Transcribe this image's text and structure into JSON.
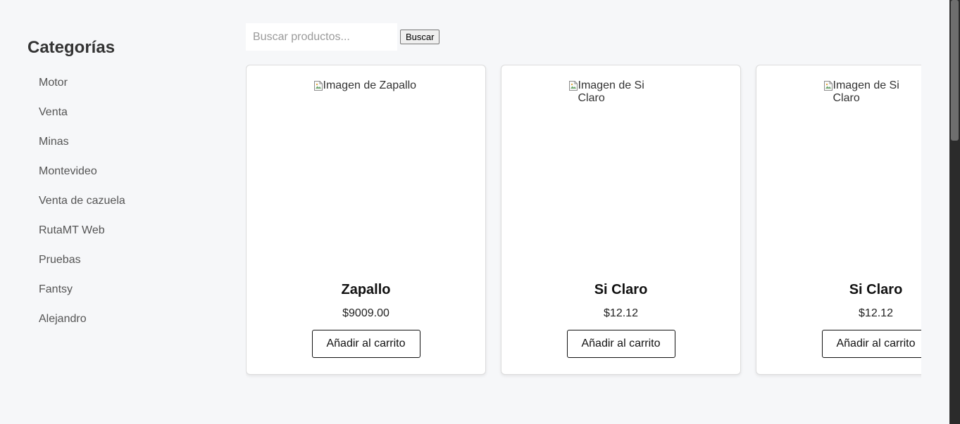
{
  "sidebar": {
    "title": "Categorías",
    "categories": [
      "Motor",
      "Venta",
      "Minas",
      "Montevideo",
      "Venta de cazuela",
      "RutaMT Web",
      "Pruebas",
      "Fantsy",
      "Alejandro"
    ]
  },
  "search": {
    "placeholder": "Buscar productos...",
    "value": "",
    "button_label": "Buscar"
  },
  "products": [
    {
      "image_alt": "Imagen de Zapallo",
      "name": "Zapallo",
      "price": "$9009.00",
      "button_label": "Añadir al carrito"
    },
    {
      "image_alt": "Imagen de Si Claro",
      "name": "Si Claro",
      "price": "$12.12",
      "button_label": "Añadir al carrito"
    },
    {
      "image_alt": "Imagen de Si Claro",
      "name": "Si Claro",
      "price": "$12.12",
      "button_label": "Añadir al carrito"
    }
  ],
  "colors": {
    "background": "#f6f7f9",
    "card_background": "#ffffff",
    "text_primary": "#111111",
    "text_muted": "#555555"
  },
  "icons": {
    "broken_image": "broken-image-icon"
  }
}
